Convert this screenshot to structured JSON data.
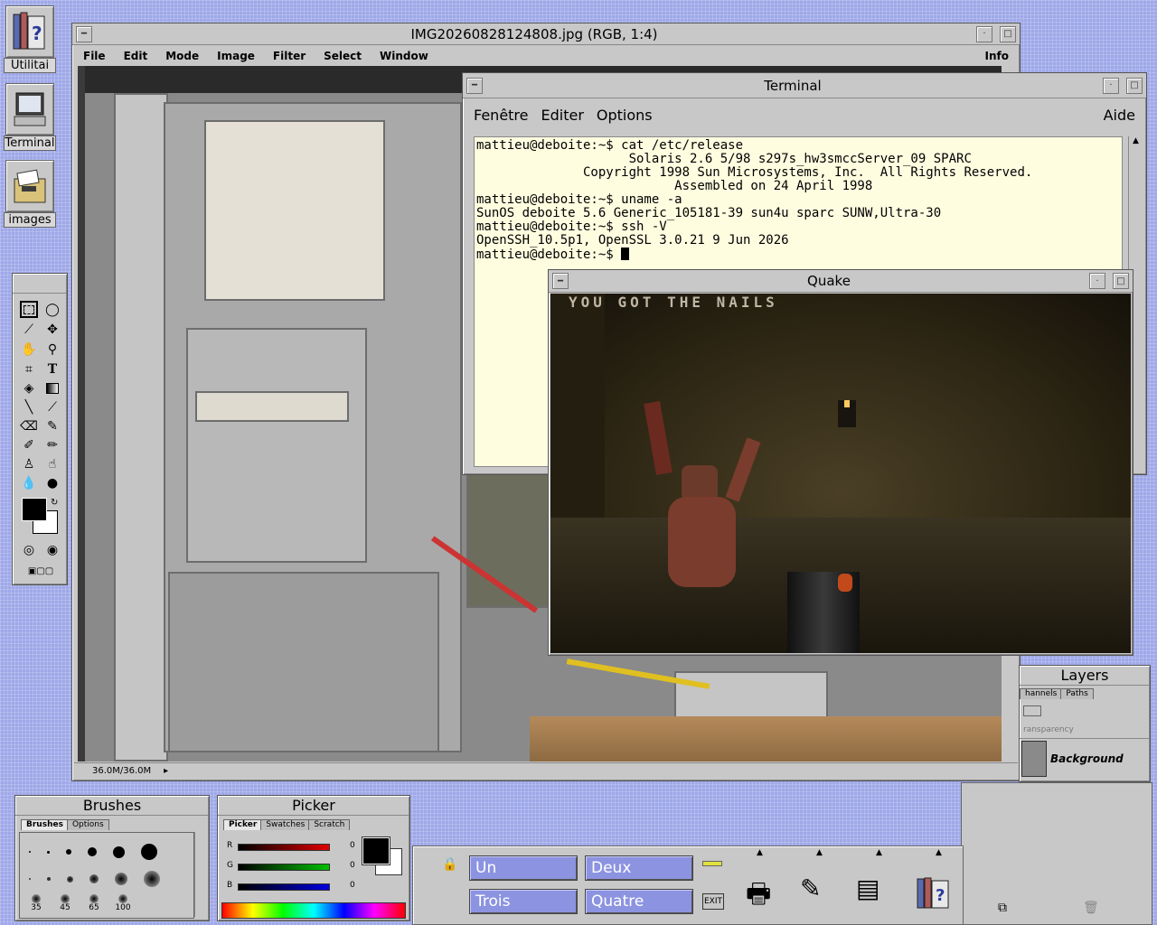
{
  "desktop_icons": [
    {
      "label": "Utilitai",
      "icon": "help-books-icon"
    },
    {
      "label": "Terminal",
      "icon": "terminal-icon"
    },
    {
      "label": "images",
      "icon": "folder-images-icon"
    }
  ],
  "image_window": {
    "title": "IMG20260828124808.jpg  (RGB, 1:4)",
    "menu": [
      "File",
      "Edit",
      "Mode",
      "Image",
      "Filter",
      "Select",
      "Window"
    ],
    "info": "Info",
    "status": "36.0M/36.0M"
  },
  "terminal": {
    "title": "Terminal",
    "menu": [
      "Fenêtre",
      "Editer",
      "Options"
    ],
    "help": "Aide",
    "lines": [
      "mattieu@deboite:~$ cat /etc/release",
      "                    Solaris 2.6 5/98 s297s_hw3smccServer_09 SPARC",
      "              Copyright 1998 Sun Microsystems, Inc.  All Rights Reserved.",
      "                          Assembled on 24 April 1998",
      "mattieu@deboite:~$ uname -a",
      "SunOS deboite 5.6 Generic_105181-39 sun4u sparc SUNW,Ultra-30",
      "mattieu@deboite:~$ ssh -V",
      "OpenSSH_10.5p1, OpenSSL 3.0.21 9 Jun 2026"
    ],
    "prompt": "mattieu@deboite:~$ "
  },
  "quake": {
    "title": "Quake",
    "message": "YOU GOT THE NAILS"
  },
  "brushes": {
    "title": "Brushes",
    "tabs": [
      "Brushes",
      "Options"
    ],
    "sizes": [
      "35",
      "45",
      "65",
      "100"
    ]
  },
  "picker": {
    "title": "Picker",
    "tabs": [
      "Picker",
      "Swatches",
      "Scratch"
    ],
    "channels": [
      {
        "label": "R",
        "value": "0",
        "color": "#e00000"
      },
      {
        "label": "G",
        "value": "0",
        "color": "#00c000"
      },
      {
        "label": "B",
        "value": "0",
        "color": "#0000e0"
      }
    ]
  },
  "layers": {
    "title": "Layers",
    "tabs": [
      "hannels",
      "Paths"
    ],
    "transparency": "ransparency",
    "layer_name": "Background"
  },
  "workspace": {
    "buttons": [
      "Un",
      "Deux",
      "Trois",
      "Quatre"
    ],
    "exit": "EXIT"
  },
  "colors": {
    "desktop": "#9fa8e8",
    "window": "#c8c8c8",
    "workspace_button": "#8c93e0",
    "terminal_bg": "#fffde0"
  }
}
